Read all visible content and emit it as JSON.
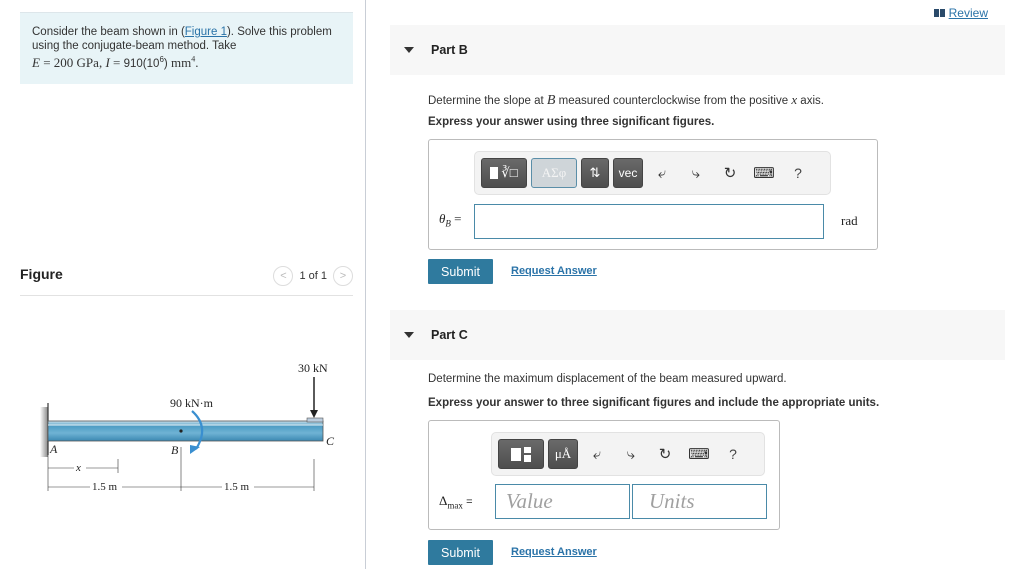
{
  "problem": {
    "text_before_link": "Consider the beam shown in (",
    "link": "Figure 1",
    "text_after_link": "). Solve this problem using the conjugate-beam method. Take",
    "given": {
      "E_symbol": "E",
      "E_value": "200 GPa",
      "I_symbol": "I",
      "I_value": "910(10",
      "I_exp": "6",
      "I_unit": ") mm",
      "I_unit_exp": "4"
    }
  },
  "figure": {
    "title": "Figure",
    "pager_text": "1 of 1",
    "prev_icon": "chevron-left-icon",
    "next_icon": "chevron-right-icon",
    "labels": {
      "force": "30 kN",
      "moment": "90 kN·m",
      "point_a": "A",
      "point_b": "B",
      "point_c": "C",
      "x_var": "x",
      "dim1": "1.5 m",
      "dim2": "1.5 m"
    }
  },
  "header": {
    "review_label": "Review",
    "review_icon": "book-icon"
  },
  "parts": [
    {
      "title": "Part B",
      "question_pre": "Determine the slope at ",
      "question_var": "B",
      "question_mid": " measured counterclockwise from the positive ",
      "question_var2": "x",
      "question_post": " axis.",
      "instruction": "Express your answer using three significant figures.",
      "toolbar": {
        "templates": "templates-icon",
        "greek": "ΑΣφ",
        "arrows": "⇅",
        "vec": "vec",
        "undo": "undo-icon",
        "redo": "redo-icon",
        "reset": "reset-icon",
        "keyboard": "keyboard-icon",
        "help": "?"
      },
      "answer_symbol": "θ",
      "answer_sub": "B",
      "equals": "=",
      "value": "",
      "unit": "rad",
      "submit_label": "Submit",
      "request_label": "Request Answer"
    },
    {
      "title": "Part C",
      "question": "Determine the maximum displacement of the beam measured upward.",
      "instruction": "Express your answer to three significant figures and include the appropriate units.",
      "toolbar": {
        "templates": "templates-icon",
        "units": "μÅ",
        "undo": "undo-icon",
        "redo": "redo-icon",
        "reset": "reset-icon",
        "keyboard": "keyboard-icon",
        "help": "?"
      },
      "answer_symbol": "Δ",
      "answer_sub": "max",
      "equals": "=",
      "value_placeholder": "Value",
      "units_placeholder": "Units",
      "submit_label": "Submit",
      "request_label": "Request Answer"
    }
  ]
}
